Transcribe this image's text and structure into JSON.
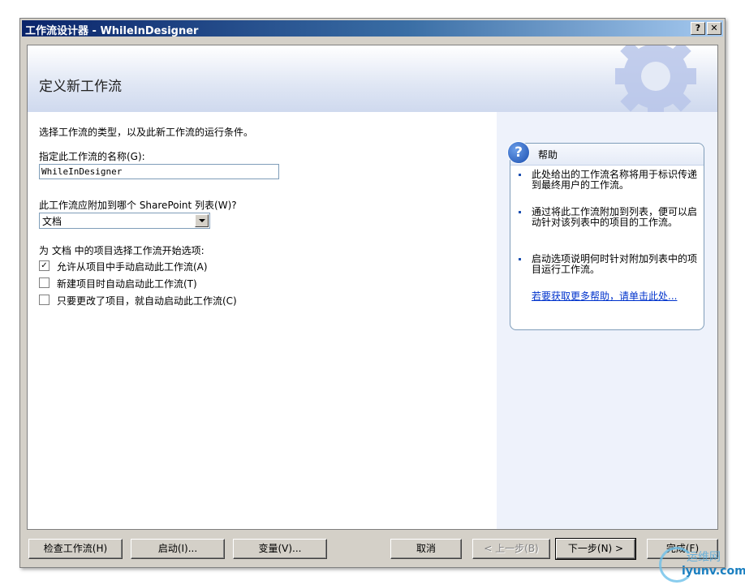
{
  "window": {
    "title": "工作流设计器 - WhileInDesigner",
    "help_btn": "?",
    "close_btn": "✕"
  },
  "banner": {
    "title": "定义新工作流"
  },
  "form": {
    "intro": "选择工作流的类型，以及此新工作流的运行条件。",
    "name_label": "指定此工作流的名称(G):",
    "name_value": "WhileInDesigner",
    "list_label": "此工作流应附加到哪个 SharePoint 列表(W)?",
    "list_value": "文档",
    "start_label": "为 文档 中的项目选择工作流开始选项:",
    "options": [
      {
        "label": "允许从项目中手动启动此工作流(A)",
        "checked": true,
        "mark": "✓"
      },
      {
        "label": "新建项目时自动启动此工作流(T)",
        "checked": false,
        "mark": ""
      },
      {
        "label": "只要更改了项目，就自动启动此工作流(C)",
        "checked": false,
        "mark": ""
      }
    ]
  },
  "help": {
    "icon": "?",
    "title": "帮助",
    "items": [
      "此处给出的工作流名称将用于标识传递到最终用户的工作流。",
      "通过将此工作流附加到列表，便可以启动针对该列表中的项目的工作流。",
      "启动选项说明何时针对附加列表中的项目运行工作流。"
    ],
    "link": "若要获取更多帮助，请单击此处..."
  },
  "buttons": {
    "check": "检查工作流(H)",
    "start": "启动(I)...",
    "variables": "变量(V)...",
    "cancel": "取消",
    "back": "< 上一步(B)",
    "next": "下一步(N) >",
    "finish": "完成(F)"
  },
  "watermark": {
    "line1": "运维网",
    "line2": "iyunv.com"
  }
}
